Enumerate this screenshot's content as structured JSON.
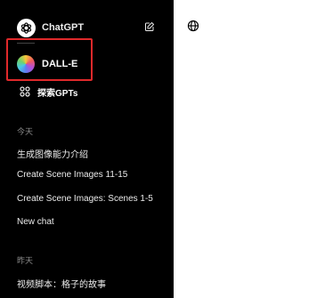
{
  "sidebar": {
    "brand_label": "ChatGPT",
    "pinned_gpt": {
      "label": "DALL-E"
    },
    "explore_label": "探索GPTs",
    "sections": [
      {
        "label": "今天",
        "items": [
          "生成图像能力介绍",
          "Create Scene Images 11-15",
          "Create Scene Images: Scenes 1-5",
          "New chat"
        ]
      },
      {
        "label": "昨天",
        "items": [
          "视频脚本：格子的故事"
        ]
      }
    ]
  },
  "main": {
    "icons": [
      "globe-icon"
    ]
  },
  "colors": {
    "sidebar_bg": "#000000",
    "highlight_border": "#e0292b",
    "muted_text": "#8e8e8e"
  }
}
